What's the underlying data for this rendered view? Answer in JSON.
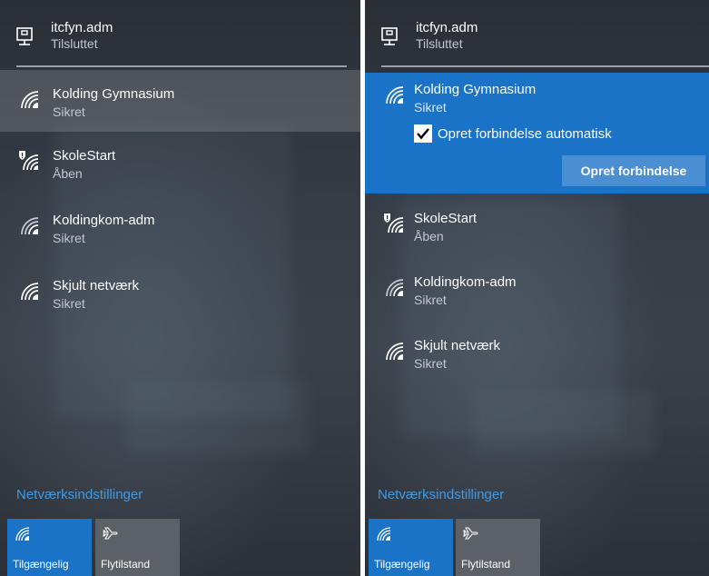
{
  "left_panel": {
    "connection": {
      "name": "itcfyn.adm",
      "status": "Tilsluttet"
    },
    "networks": [
      {
        "name": "Kolding Gymnasium",
        "security": "Sikret"
      },
      {
        "name": "SkoleStart",
        "security": "Åben"
      },
      {
        "name": "Koldingkom-adm",
        "security": "Sikret"
      },
      {
        "name": "Skjult netværk",
        "security": "Sikret"
      }
    ],
    "settings_link": "Netværksindstillinger",
    "tiles": [
      {
        "label": "Tilgængelig",
        "icon": "wifi-icon",
        "state": "on"
      },
      {
        "label": "Flytilstand",
        "icon": "airplane-icon",
        "state": "off"
      }
    ]
  },
  "right_panel": {
    "connection": {
      "name": "itcfyn.adm",
      "status": "Tilsluttet"
    },
    "expanded_network": {
      "name": "Kolding Gymnasium",
      "security": "Sikret",
      "auto_connect_label": "Opret forbindelse automatisk",
      "auto_connect_checked": true,
      "connect_button": "Opret forbindelse"
    },
    "networks": [
      {
        "name": "SkoleStart",
        "security": "Åben"
      },
      {
        "name": "Koldingkom-adm",
        "security": "Sikret"
      },
      {
        "name": "Skjult netværk",
        "security": "Sikret"
      }
    ],
    "settings_link": "Netværksindstillinger",
    "tiles": [
      {
        "label": "Tilgængelig",
        "icon": "wifi-icon",
        "state": "on"
      },
      {
        "label": "Flytilstand",
        "icon": "airplane-icon",
        "state": "off"
      }
    ]
  },
  "colors": {
    "accent": "#1a73c7",
    "link": "#3f9be8",
    "tile_off": "#5c6167"
  }
}
